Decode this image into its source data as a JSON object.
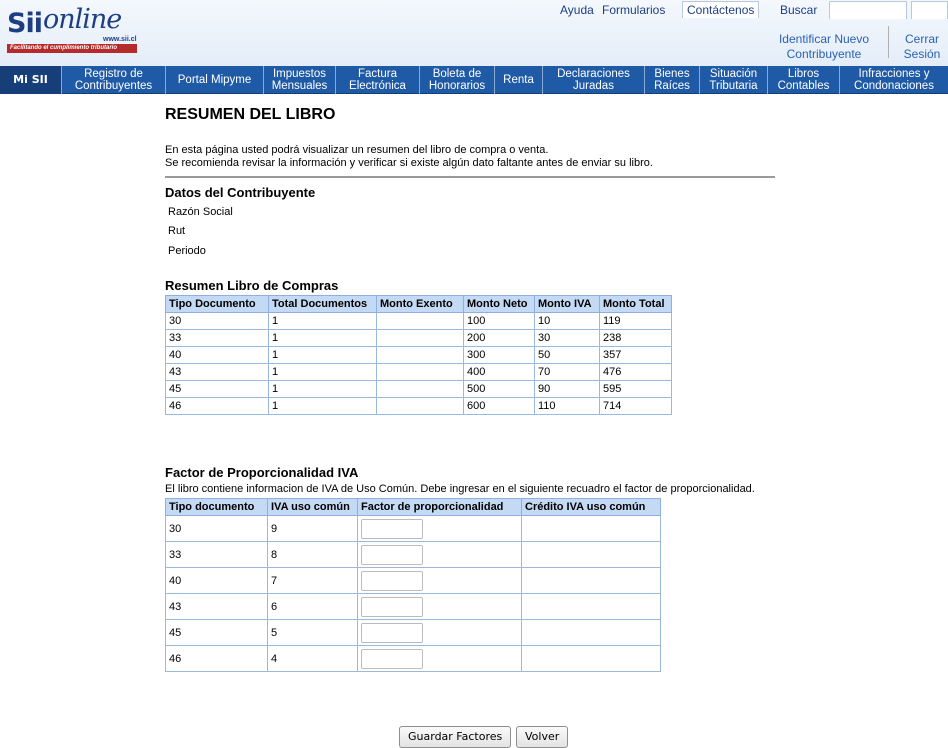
{
  "header": {
    "logo": {
      "brand": "Sii",
      "wordmark": "online",
      "url": "www.sii.cl",
      "tagline": "Facilitando el cumplimiento tributario"
    },
    "top_links": [
      "Ayuda",
      "Formularios",
      "Contáctenos",
      "Buscar"
    ],
    "user_links": {
      "identify": "Identificar Nuevo Contribuyente",
      "logout": "Cerrar Sesión"
    }
  },
  "nav": {
    "items": [
      "Mi SII",
      "Registro de Contribuyentes",
      "Portal Mipyme",
      "Impuestos Mensuales",
      "Factura Electrónica",
      "Boleta de Honorarios",
      "Renta",
      "Declaraciones Juradas",
      "Bienes Raíces",
      "Situación Tributaria",
      "Libros Contables",
      "Infracciones y Condonaciones"
    ]
  },
  "page": {
    "title": "RESUMEN DEL LIBRO",
    "intro_line1": "En esta página usted podrá visualizar un resumen del libro de compra o venta.",
    "intro_line2": "Se recomienda revisar la información y verificar si existe algún dato faltante antes de enviar su libro."
  },
  "taxpayer": {
    "title": "Datos del Contribuyente",
    "fields": [
      "Razón Social",
      "Rut",
      "Periodo"
    ]
  },
  "purchases": {
    "title": "Resumen Libro de Compras",
    "columns": [
      "Tipo Documento",
      "Total Documentos",
      "Monto Exento",
      "Monto Neto",
      "Monto IVA",
      "Monto Total"
    ],
    "rows": [
      [
        "30",
        "1",
        "",
        "100",
        "10",
        "119"
      ],
      [
        "33",
        "1",
        "",
        "200",
        "30",
        "238"
      ],
      [
        "40",
        "1",
        "",
        "300",
        "50",
        "357"
      ],
      [
        "43",
        "1",
        "",
        "400",
        "70",
        "476"
      ],
      [
        "45",
        "1",
        "",
        "500",
        "90",
        "595"
      ],
      [
        "46",
        "1",
        "",
        "600",
        "110",
        "714"
      ]
    ]
  },
  "factor": {
    "title": "Factor de Proporcionalidad IVA",
    "note": "El libro contiene informacion de IVA de Uso Común. Debe ingresar en el siguiente recuadro el factor de proporcionalidad.",
    "columns": [
      "Tipo documento",
      "IVA uso común",
      "Factor de proporcionalidad",
      "Crédito IVA uso común"
    ],
    "rows": [
      [
        "30",
        "9",
        "",
        ""
      ],
      [
        "33",
        "8",
        "",
        ""
      ],
      [
        "40",
        "7",
        "",
        ""
      ],
      [
        "43",
        "6",
        "",
        ""
      ],
      [
        "45",
        "5",
        "",
        ""
      ],
      [
        "46",
        "4",
        "",
        ""
      ]
    ]
  },
  "actions": {
    "save": "Guardar Factores",
    "back": "Volver"
  }
}
